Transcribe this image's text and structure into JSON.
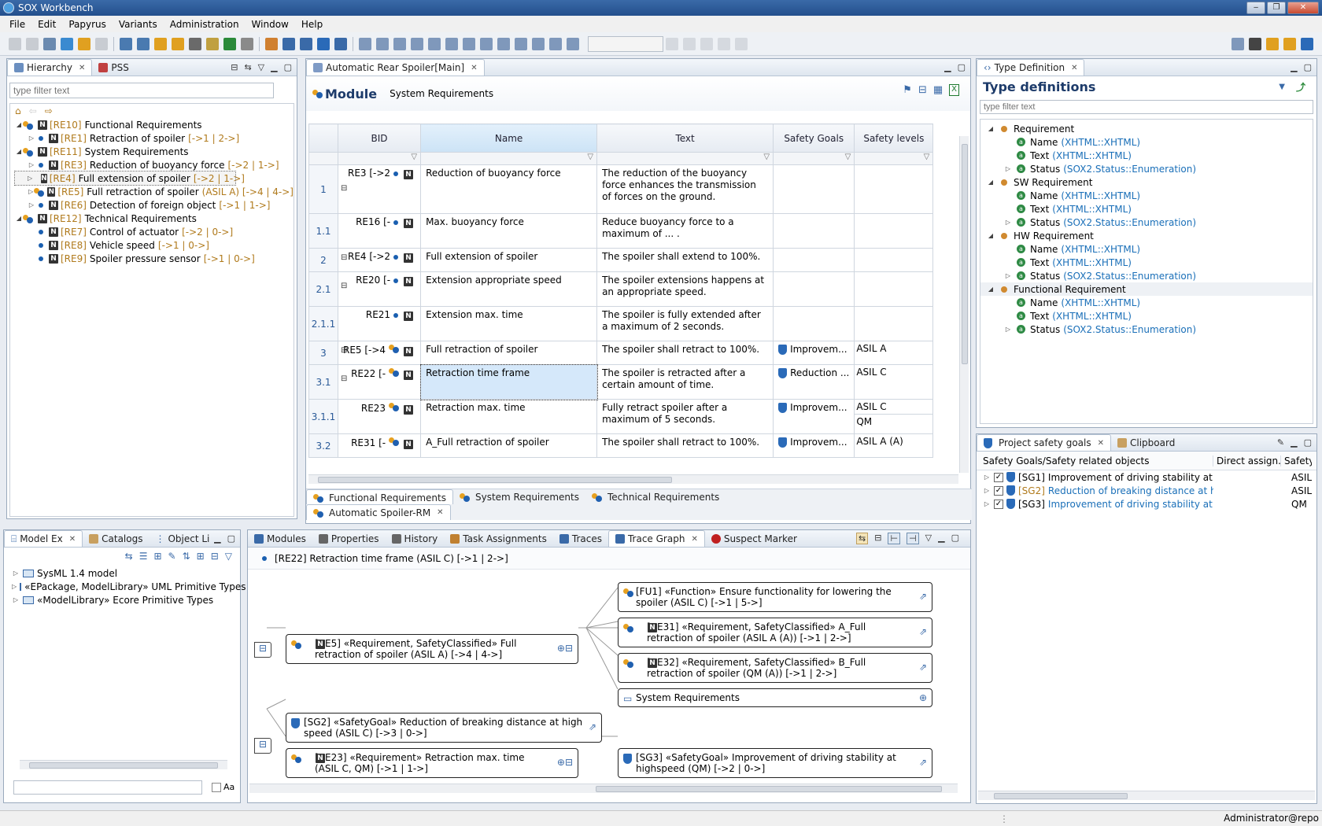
{
  "window": {
    "title": "SOX Workbench"
  },
  "menu": [
    "File",
    "Edit",
    "Papyrus",
    "Variants",
    "Administration",
    "Window",
    "Help"
  ],
  "hierarchy": {
    "tabs": [
      "Hierarchy",
      "PSS"
    ],
    "filter_placeholder": "type filter text",
    "items": [
      {
        "id": "[RE10]",
        "label": "Functional Requirements",
        "suffix": ""
      },
      {
        "id": "[RE1]",
        "label": "Retraction of spoiler",
        "suffix": "[->1 | 2->]"
      },
      {
        "id": "[RE11]",
        "label": "System Requirements",
        "suffix": ""
      },
      {
        "id": "[RE3]",
        "label": "Reduction of buoyancy force",
        "suffix": "[->2 | 1->]"
      },
      {
        "id": "[RE4]",
        "label": "Full extension of spoiler",
        "suffix": "[->2 | 1->]"
      },
      {
        "id": "[RE5]",
        "label": "Full retraction of spoiler",
        "suffix": "(ASIL A) [->4 | 4->]"
      },
      {
        "id": "[RE6]",
        "label": "Detection of foreign object",
        "suffix": "[->1 | 1->]"
      },
      {
        "id": "[RE12]",
        "label": "Technical Requirements",
        "suffix": ""
      },
      {
        "id": "[RE7]",
        "label": "Control of actuator",
        "suffix": "[->2 | 0->]"
      },
      {
        "id": "[RE8]",
        "label": "Vehicle speed",
        "suffix": "[->1 | 0->]"
      },
      {
        "id": "[RE9]",
        "label": "Spoiler pressure sensor",
        "suffix": "[->1 | 0->]"
      }
    ]
  },
  "editor": {
    "tab": "Automatic Rear Spoiler[Main]",
    "module_label": "Module",
    "module_name": "System Requirements",
    "columns": [
      "BID",
      "Name",
      "Text",
      "Safety Goals",
      "Safety levels"
    ],
    "rows": [
      {
        "num": "1",
        "bid": "RE3 [->2",
        "name": "Reduction of buoyancy force",
        "text": "The reduction of the buoyancy force enhances the transmission of forces on the ground.",
        "goal": "",
        "level": "",
        "level2": ""
      },
      {
        "num": "1.1",
        "bid": "RE16 [-",
        "name": "Max. buoyancy force",
        "text": "Reduce buoyancy force to a maximum of ... .",
        "goal": "",
        "level": "",
        "level2": ""
      },
      {
        "num": "2",
        "bid": "RE4 [->2",
        "name": "Full extension of spoiler",
        "text": "The spoiler shall extend to 100%.",
        "goal": "",
        "level": "",
        "level2": ""
      },
      {
        "num": "2.1",
        "bid": "RE20 [-",
        "name": "Extension appropriate speed",
        "text": "The spoiler extensions happens at an appropriate speed.",
        "goal": "",
        "level": "",
        "level2": ""
      },
      {
        "num": "2.1.1",
        "bid": "RE21",
        "name": "Extension max. time",
        "text": "The spoiler is fully extended after a maximum of 2 seconds.",
        "goal": "",
        "level": "",
        "level2": ""
      },
      {
        "num": "3",
        "bid": "RE5 [->4",
        "name": "Full retraction of spoiler",
        "text": "The spoiler shall retract to 100%.",
        "goal": "Improvem...",
        "level": "ASIL A",
        "level2": ""
      },
      {
        "num": "3.1",
        "bid": "RE22 [-",
        "name": "Retraction time frame",
        "text": "The spoiler is retracted after a certain amount of time.",
        "goal": "Reduction ...",
        "level": "ASIL C",
        "level2": ""
      },
      {
        "num": "3.1.1",
        "bid": "RE23",
        "name": "Retraction max. time",
        "text": "Fully retract spoiler after a maximum of 5 seconds.",
        "goal": "Improvem...",
        "level": "ASIL C",
        "level2": "QM"
      },
      {
        "num": "3.2",
        "bid": "RE31 [-",
        "name": "A_Full retraction of spoiler",
        "text": "The spoiler shall retract to 100%.",
        "goal": "Improvem...",
        "level": "ASIL A (A)",
        "level2": ""
      }
    ],
    "bottom_tabs": [
      "Functional Requirements",
      "System Requirements",
      "Technical Requirements"
    ],
    "second_tab": "Automatic Spoiler-RM"
  },
  "typedef": {
    "tab": "Type Definition",
    "title": "Type definitions",
    "filter_placeholder": "type filter text",
    "types": [
      {
        "name": "Requirement",
        "attrs": [
          [
            "Name",
            "(XHTML::XHTML)"
          ],
          [
            "Text",
            "(XHTML::XHTML)"
          ],
          [
            "Status",
            "(SOX2.Status::Enumeration)"
          ]
        ]
      },
      {
        "name": "SW Requirement",
        "attrs": [
          [
            "Name",
            "(XHTML::XHTML)"
          ],
          [
            "Text",
            "(XHTML::XHTML)"
          ],
          [
            "Status",
            "(SOX2.Status::Enumeration)"
          ]
        ]
      },
      {
        "name": "HW Requirement",
        "attrs": [
          [
            "Name",
            "(XHTML::XHTML)"
          ],
          [
            "Text",
            "(XHTML::XHTML)"
          ],
          [
            "Status",
            "(SOX2.Status::Enumeration)"
          ]
        ]
      },
      {
        "name": "Functional Requirement",
        "attrs": [
          [
            "Name",
            "(XHTML::XHTML)"
          ],
          [
            "Text",
            "(XHTML::XHTML)"
          ],
          [
            "Status",
            "(SOX2.Status::Enumeration)"
          ]
        ]
      }
    ]
  },
  "safety": {
    "tabs": [
      "Project safety goals",
      "Clipboard"
    ],
    "columns": [
      "Safety Goals/Safety related objects",
      "Direct assign...",
      "Safety"
    ],
    "rows": [
      {
        "id": "[SG1]",
        "label": "Improvement of driving stability at high",
        "level": "ASIL"
      },
      {
        "id": "[SG2]",
        "label": "Reduction of breaking distance at high s",
        "level": "ASIL"
      },
      {
        "id": "[SG3]",
        "label": "Improvement of driving stability at high",
        "level": "QM"
      }
    ]
  },
  "model": {
    "tabs": [
      "Model Ex",
      "Catalogs",
      "Object Li"
    ],
    "items": [
      "SysML 1.4 model",
      "«EPackage, ModelLibrary» UML Primitive Types",
      "«ModelLibrary» Ecore Primitive Types"
    ],
    "case_label": "Aa"
  },
  "trace": {
    "tabs": [
      "Modules",
      "Properties",
      "History",
      "Task Assignments",
      "Traces",
      "Trace Graph",
      "Suspect Marker"
    ],
    "header": "[RE22] Retraction time frame (ASIL C) [->1 | 2->]",
    "nodes": {
      "re5": "[RE5] «Requirement, SafetyClassified» Full retraction of spoiler (ASIL A) [->4 | 4->]",
      "fu1": "[FU1] «Function» Ensure functionality for lowering the spoiler (ASIL C) [->1 | 5->]",
      "re31": "[RE31] «Requirement, SafetyClassified» A_Full retraction of spoiler (ASIL A (A)) [->1 | 2->]",
      "re32": "[RE32] «Requirement, SafetyClassified» B_Full retraction of spoiler (QM (A)) [->1 | 2->]",
      "sysreq": "System Requirements",
      "sg2": "[SG2] «SafetyGoal» Reduction of breaking distance at high speed (ASIL C) [->3 | 0->]",
      "re23": "[RE23] «Requirement» Retraction max. time (ASIL C, QM) [->1 | 1->]",
      "sg3": "[SG3] «SafetyGoal» Improvement of driving stability at highspeed (QM) [->2 | 0->]"
    }
  },
  "status": {
    "user": "Administrator@repo"
  }
}
